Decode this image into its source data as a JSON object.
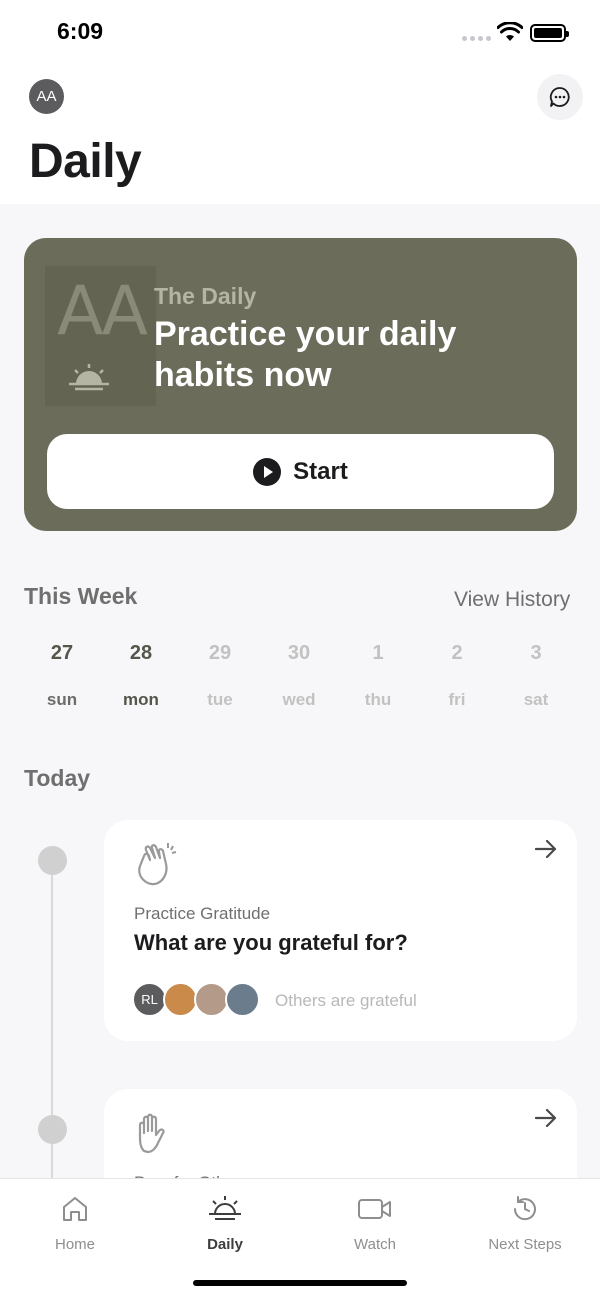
{
  "status_bar": {
    "time": "6:09"
  },
  "header": {
    "avatar_initials": "AA",
    "title": "Daily"
  },
  "hero": {
    "logo_text": "AA",
    "subtitle": "The Daily",
    "title": "Practice your daily habits now",
    "start_label": "Start",
    "background_color": "#6c6c5b"
  },
  "week": {
    "title": "This Week",
    "view_history": "View History",
    "days": [
      {
        "num": "27",
        "name": "sun",
        "state": "past"
      },
      {
        "num": "28",
        "name": "mon",
        "state": "current"
      },
      {
        "num": "29",
        "name": "tue",
        "state": "future"
      },
      {
        "num": "30",
        "name": "wed",
        "state": "future"
      },
      {
        "num": "1",
        "name": "thu",
        "state": "future"
      },
      {
        "num": "2",
        "name": "fri",
        "state": "future"
      },
      {
        "num": "3",
        "name": "sat",
        "state": "future"
      }
    ]
  },
  "today": {
    "title": "Today",
    "cards": [
      {
        "icon": "clapping-hands-icon",
        "subtitle": "Practice Gratitude",
        "title": "What are you grateful for?",
        "avatar_initials": "RL",
        "others_text": "Others are grateful"
      },
      {
        "icon": "raised-hand-icon",
        "subtitle": "Pray for Others"
      }
    ]
  },
  "tabs": [
    {
      "label": "Home",
      "icon": "home-icon",
      "active": false
    },
    {
      "label": "Daily",
      "icon": "sunrise-icon",
      "active": true
    },
    {
      "label": "Watch",
      "icon": "video-camera-icon",
      "active": false
    },
    {
      "label": "Next Steps",
      "icon": "history-clock-icon",
      "active": false
    }
  ]
}
